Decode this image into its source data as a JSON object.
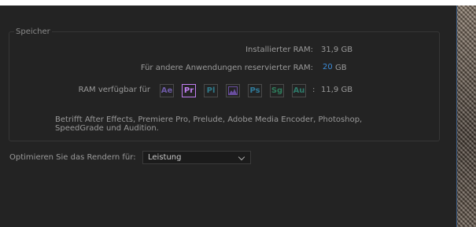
{
  "memory": {
    "group_title": "Speicher",
    "installed_label": "Installierter RAM:",
    "installed_value": "31,9 GB",
    "reserved_label": "Für andere Anwendungen reservierter RAM:",
    "reserved_value": "20",
    "reserved_unit": "GB",
    "available_label": "RAM verfügbar für",
    "available_separator": ":",
    "available_value": "11,9 GB",
    "apps": [
      {
        "abbr": "Ae",
        "color": "#6d5aa6"
      },
      {
        "abbr": "Pr",
        "color": "#c07ef0"
      },
      {
        "abbr": "Pl",
        "color": "#2f7a8a"
      },
      {
        "abbr": "Me",
        "color": "#6a4ea0"
      },
      {
        "abbr": "Ps",
        "color": "#2f7a9a"
      },
      {
        "abbr": "Sg",
        "color": "#2e7a5a"
      },
      {
        "abbr": "Au",
        "color": "#2e7a6a"
      }
    ],
    "description": "Betrifft After Effects, Premiere Pro, Prelude, Adobe Media Encoder, Photoshop, SpeedGrade und Audition."
  },
  "render": {
    "label": "Optimieren Sie das Rendern für:",
    "selected": "Leistung"
  }
}
